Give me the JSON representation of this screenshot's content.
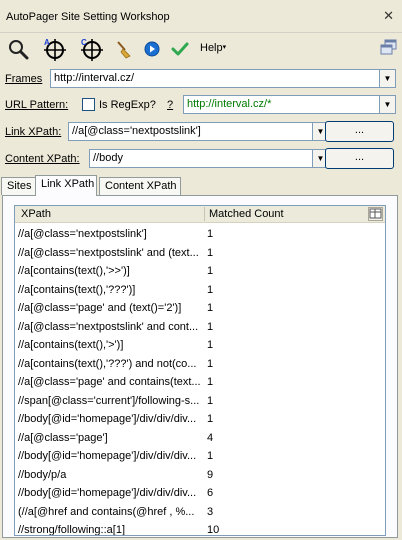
{
  "window": {
    "title": "AutoPager Site Setting Workshop",
    "close": "✕"
  },
  "toolbar": {
    "icons": [
      "magnifier-icon",
      "crosshair-a-icon",
      "crosshair-c-icon",
      "broom-icon",
      "play-icon",
      "check-icon"
    ],
    "help": "Help",
    "help_arrow": "▾",
    "colors": {
      "crosshair": "#000000",
      "badge": "#1b3fd0",
      "check": "#2fa84f",
      "play": "#1a6fd1",
      "broom": "#d8a838"
    }
  },
  "frames": {
    "label": "Frames",
    "value": "http://interval.cz/"
  },
  "url_pattern": {
    "label": "URL Pattern:",
    "regexp_label": "Is RegExp?",
    "help": "?",
    "value": "http://interval.cz/*",
    "color": "#007a00"
  },
  "link_xpath": {
    "label": "Link XPath:",
    "value": "//a[@class='nextpostslink']",
    "button": "..."
  },
  "content_xpath": {
    "label": "Content XPath:",
    "value": "//body",
    "button": "..."
  },
  "tabs": [
    {
      "label": "Sites",
      "active": false
    },
    {
      "label": "Link XPath",
      "active": true
    },
    {
      "label": "Content XPath",
      "active": false
    }
  ],
  "table": {
    "columns": [
      "XPath",
      "Matched Count"
    ],
    "rows": [
      {
        "xpath": "//a[@class='nextpostslink']",
        "count": "1"
      },
      {
        "xpath": "//a[@class='nextpostslink' and (text...",
        "count": "1"
      },
      {
        "xpath": "//a[contains(text(),'>>')]",
        "count": "1"
      },
      {
        "xpath": "//a[contains(text(),'???')]",
        "count": "1"
      },
      {
        "xpath": "//a[@class='page' and (text()='2')]",
        "count": "1"
      },
      {
        "xpath": "//a[@class='nextpostslink' and cont...",
        "count": "1"
      },
      {
        "xpath": "//a[contains(text(),'>')]",
        "count": "1"
      },
      {
        "xpath": "//a[contains(text(),'???') and not(co...",
        "count": "1"
      },
      {
        "xpath": "//a[@class='page' and contains(text...",
        "count": "1"
      },
      {
        "xpath": "//span[@class='current']/following-s...",
        "count": "1"
      },
      {
        "xpath": "//body[@id='homepage']/div/div/div...",
        "count": "1"
      },
      {
        "xpath": "//a[@class='page']",
        "count": "4"
      },
      {
        "xpath": "//body[@id='homepage']/div/div/div...",
        "count": "1"
      },
      {
        "xpath": "//body/p/a",
        "count": "9"
      },
      {
        "xpath": "//body[@id='homepage']/div/div/div...",
        "count": "6"
      },
      {
        "xpath": "(//a[@href and contains(@href , %...",
        "count": "3"
      },
      {
        "xpath": "//strong/following::a[1]",
        "count": "10"
      }
    ]
  }
}
